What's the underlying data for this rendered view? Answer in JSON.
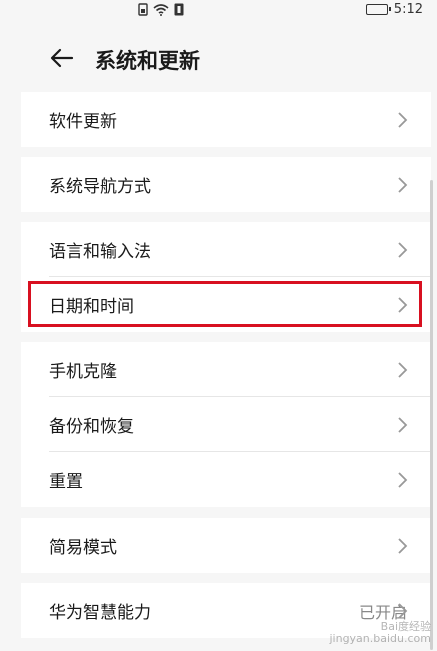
{
  "status_bar": {
    "time": "5:12",
    "icons": [
      "sim-icon",
      "wifi-icon",
      "nfc-icon",
      "battery-icon"
    ]
  },
  "header": {
    "title": "系统和更新",
    "back_icon": "back-arrow-icon"
  },
  "groups": [
    {
      "items": [
        {
          "label": "软件更新"
        }
      ]
    },
    {
      "items": [
        {
          "label": "系统导航方式"
        }
      ]
    },
    {
      "items": [
        {
          "label": "语言和输入法"
        },
        {
          "label": "日期和时间",
          "highlighted": true
        }
      ]
    },
    {
      "items": [
        {
          "label": "手机克隆"
        },
        {
          "label": "备份和恢复"
        },
        {
          "label": "重置"
        }
      ]
    },
    {
      "items": [
        {
          "label": "简易模式"
        }
      ]
    },
    {
      "items": [
        {
          "label": "华为智慧能力",
          "value": "已开启"
        }
      ]
    }
  ],
  "watermark": {
    "line1": "Bai度经验",
    "line2": "jingyan.baidu.com"
  },
  "colors": {
    "highlight_border": "#d81020",
    "background": "#f6f6f6",
    "card": "#ffffff"
  }
}
